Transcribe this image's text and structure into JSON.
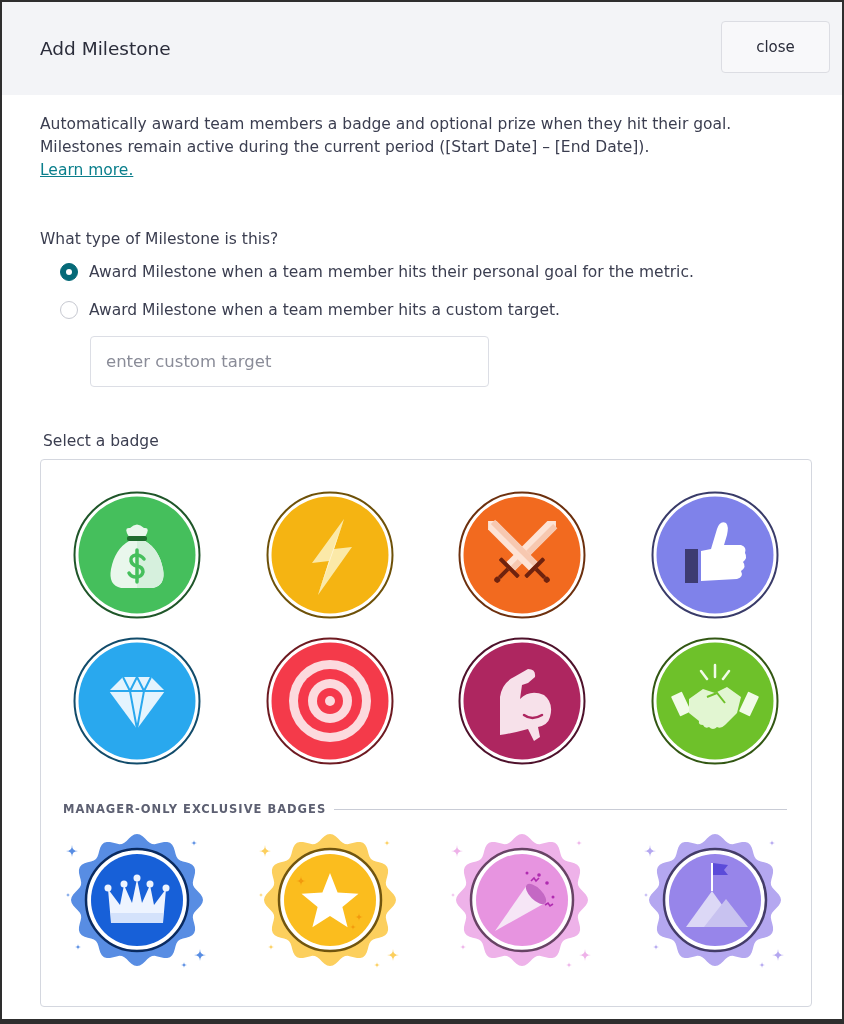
{
  "dialog": {
    "title": "Add Milestone",
    "close_button": "close"
  },
  "intro": {
    "lines": [
      "Automatically award team members a badge and optional prize when they hit their goal.",
      "Milestones remain active during the current period ([Start Date] – [End Date])."
    ],
    "link": "Learn more."
  },
  "milestone_type": {
    "label": "What type of Milestone is this?",
    "options": [
      {
        "label": "Award Milestone when a team member hits their personal goal for the metric.",
        "selected": true
      },
      {
        "label": "Award Milestone when a team member hits a custom target.",
        "selected": false
      }
    ],
    "custom_target": {
      "placeholder": "enter custom target"
    }
  },
  "badges": {
    "label": "Select a badge",
    "standard": [
      {
        "kind": "money",
        "color": "#45bf5c"
      },
      {
        "kind": "bolt",
        "color": "#f5b412"
      },
      {
        "kind": "swords",
        "color": "#f26a1f"
      },
      {
        "kind": "thumb",
        "color": "#7f82ea"
      },
      {
        "kind": "diamond",
        "color": "#29a8ee"
      },
      {
        "kind": "target",
        "color": "#f43a4a"
      },
      {
        "kind": "muscle",
        "color": "#ae2660"
      },
      {
        "kind": "handshake",
        "color": "#6ec12a"
      }
    ],
    "exclusive_heading": "MANAGER-ONLY EXCLUSIVE BADGES",
    "exclusive": [
      {
        "kind": "crown",
        "color": "#1760d8"
      },
      {
        "kind": "star",
        "color": "#fbbd1e"
      },
      {
        "kind": "confetti",
        "color": "#e794e0"
      },
      {
        "kind": "mountain",
        "color": "#9785ea"
      }
    ]
  }
}
